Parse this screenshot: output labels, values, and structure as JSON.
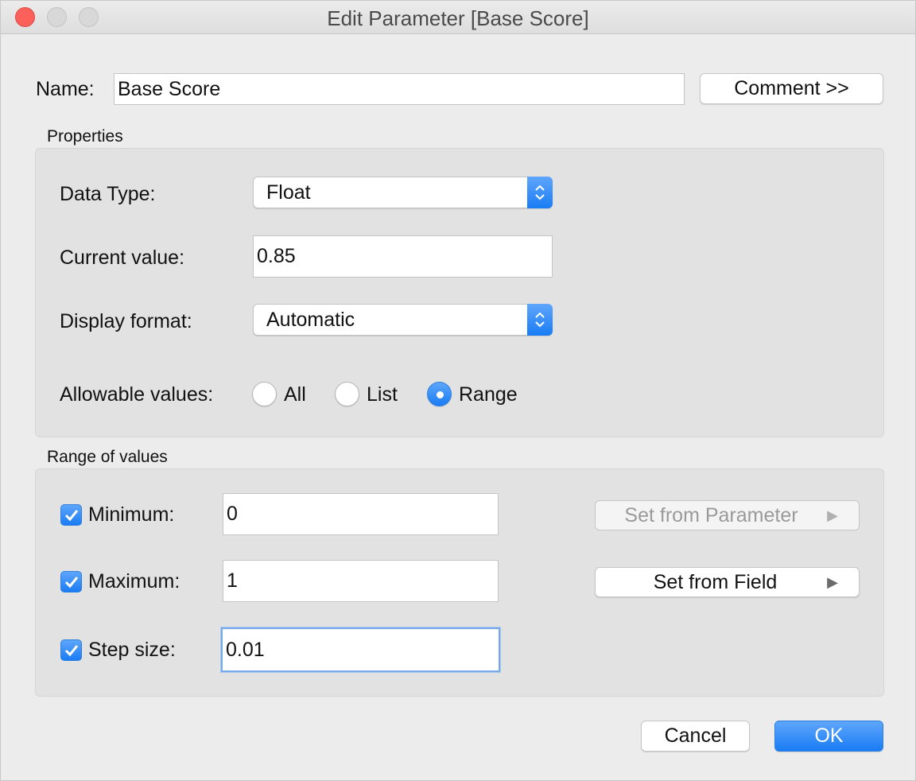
{
  "window": {
    "title": "Edit Parameter [Base Score]"
  },
  "name": {
    "label": "Name:",
    "value": "Base Score",
    "comment_button": "Comment >>"
  },
  "properties": {
    "section_title": "Properties",
    "data_type": {
      "label": "Data Type:",
      "value": "Float"
    },
    "current_value": {
      "label": "Current value:",
      "value": "0.85"
    },
    "display_format": {
      "label": "Display format:",
      "value": "Automatic"
    },
    "allowable_values": {
      "label": "Allowable values:",
      "options": [
        "All",
        "List",
        "Range"
      ],
      "selected": "Range"
    }
  },
  "range": {
    "section_title": "Range of values",
    "minimum": {
      "label": "Minimum:",
      "value": "0",
      "checked": true
    },
    "maximum": {
      "label": "Maximum:",
      "value": "1",
      "checked": true
    },
    "step_size": {
      "label": "Step size:",
      "value": "0.01",
      "checked": true
    },
    "set_from_parameter": "Set from Parameter",
    "set_from_field": "Set from Field"
  },
  "footer": {
    "cancel": "Cancel",
    "ok": "OK"
  },
  "colors": {
    "accent": "#1a7cf4",
    "close": "#fc605b",
    "background": "#ececec",
    "group": "#e2e2e2"
  },
  "icons": [
    "close-icon",
    "minimize-icon",
    "zoom-icon",
    "stepper-updown-icon",
    "checkmark-icon",
    "play-arrow-icon"
  ]
}
